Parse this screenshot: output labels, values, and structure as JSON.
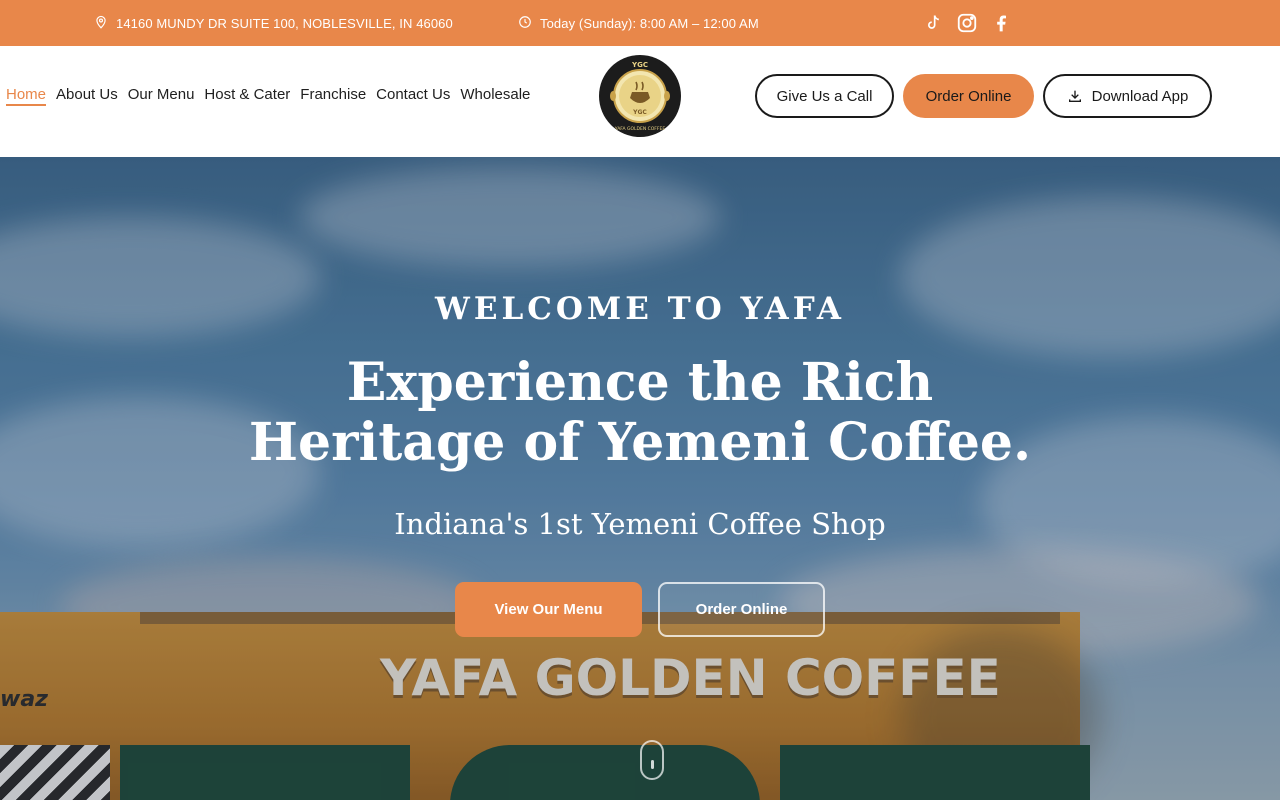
{
  "topbar": {
    "address": "14160 MUNDY DR SUITE 100, NOBLESVILLE, IN 46060",
    "hours": "Today (Sunday): 8:00 AM – 12:00 AM",
    "socials": [
      "tiktok-icon",
      "instagram-icon",
      "facebook-icon"
    ]
  },
  "nav": {
    "items": [
      {
        "label": "Home",
        "active": true
      },
      {
        "label": "About Us"
      },
      {
        "label": "Our Menu"
      },
      {
        "label": "Host & Cater"
      },
      {
        "label": "Franchise"
      },
      {
        "label": "Contact Us"
      },
      {
        "label": "Wholesale"
      }
    ]
  },
  "logo": {
    "top_text": "YGC",
    "mid_text": "YGC",
    "ring_text": "YAFA GOLDEN COFFEE"
  },
  "header_buttons": {
    "call": "Give Us a Call",
    "order": "Order Online",
    "app": "Download App"
  },
  "hero": {
    "eyebrow": "WELCOME TO YAFA",
    "headline_line1": "Experience the Rich",
    "headline_line2": "Heritage of Yemeni Coffee.",
    "subheadline": "Indiana's 1st Yemeni Coffee Shop",
    "cta_menu": "View Our Menu",
    "cta_order": "Order Online",
    "sign_text": "YAFA GOLDEN COFFEE",
    "sign_left_text": "waz"
  },
  "colors": {
    "accent": "#E8874A",
    "dark": "#1a1a1a",
    "sky": "#4e7ea3"
  }
}
